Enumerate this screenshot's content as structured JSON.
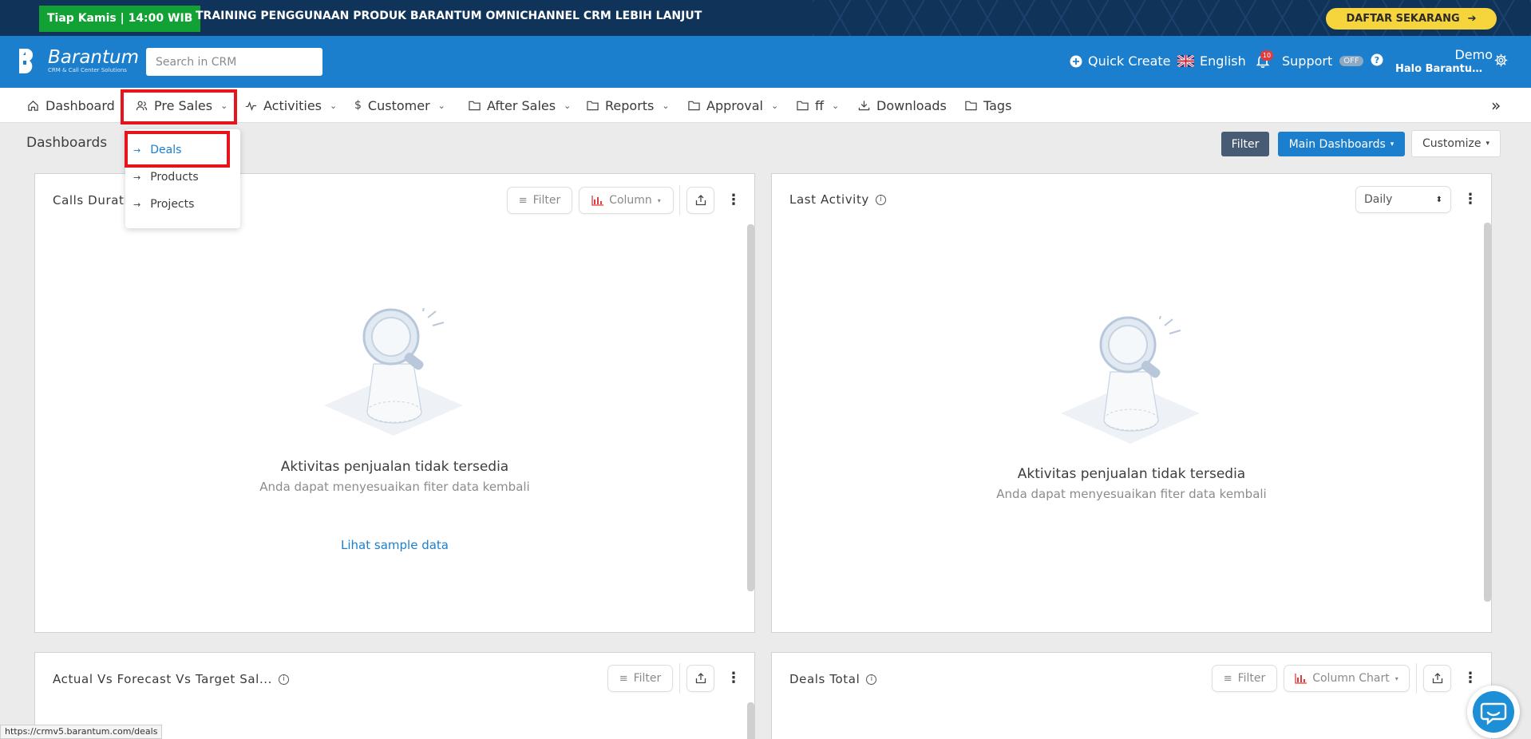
{
  "promo": {
    "badge": "Tiap Kamis | 14:00 WIB",
    "text": "TRAINING PENGGUNAAN PRODUK BARANTUM OMNICHANNEL CRM LEBIH LANJUT",
    "cta": "DAFTAR SEKARANG"
  },
  "header": {
    "logo_name": "Barantum",
    "logo_sub": "CRM & Call Center Solutions",
    "search_placeholder": "Search in CRM",
    "quick_create": "Quick Create",
    "language": "English",
    "notification_count": "10",
    "support": "Support",
    "support_toggle": "OFF",
    "user_name": "Demo",
    "user_greeting": "Halo Barantum Demo"
  },
  "nav": {
    "items": [
      {
        "label": "Dashboard",
        "icon": "home-icon"
      },
      {
        "label": "Pre Sales",
        "icon": "users-icon"
      },
      {
        "label": "Activities",
        "icon": "activity-icon"
      },
      {
        "label": "Customer",
        "icon": "dollar-icon"
      },
      {
        "label": "After Sales",
        "icon": "folder-icon"
      },
      {
        "label": "Reports",
        "icon": "folder-icon"
      },
      {
        "label": "Approval",
        "icon": "folder-icon"
      },
      {
        "label": "ff",
        "icon": "folder-icon"
      },
      {
        "label": "Downloads",
        "icon": "download-icon"
      },
      {
        "label": "Tags",
        "icon": "folder-icon"
      }
    ]
  },
  "dropdown": {
    "items": [
      "Deals",
      "Products",
      "Projects"
    ]
  },
  "page": {
    "title": "Dashboards",
    "filter": "Filter",
    "main_dashboards": "Main Dashboards",
    "customize": "Customize"
  },
  "cards": [
    {
      "title": "Calls Duration ... h ...",
      "filter": "Filter",
      "chart_type": "Column",
      "empty_title": "Aktivitas penjualan tidak tersedia",
      "empty_sub": "Anda dapat menyesuaikan fiter data kembali",
      "link": "Lihat sample data"
    },
    {
      "title": "Last Activity",
      "period": "Daily",
      "empty_title": "Aktivitas penjualan tidak tersedia",
      "empty_sub": "Anda dapat menyesuaikan fiter data kembali"
    },
    {
      "title": "Actual Vs Forecast Vs Target Sal...",
      "filter": "Filter"
    },
    {
      "title": "Deals Total",
      "filter": "Filter",
      "chart_type": "Column Chart"
    }
  ],
  "status_url": "https://crmv5.barantum.com/deals",
  "colors": {
    "brand": "#1c7fcd",
    "banner": "#10335a",
    "highlight": "#e8141d",
    "cta": "#f6d43c"
  }
}
